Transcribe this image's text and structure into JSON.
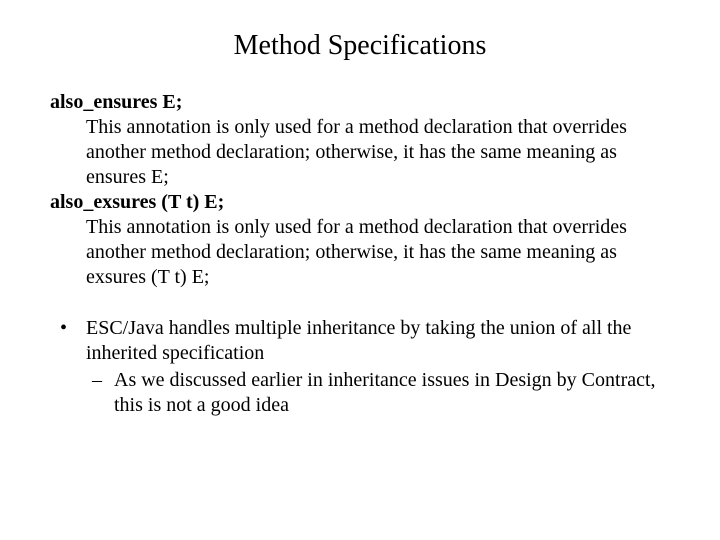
{
  "title": "Method Specifications",
  "specs": [
    {
      "term": "also_ensures E;",
      "desc": "This annotation is only used for a method declaration that overrides another method declaration; otherwise, it has the same meaning as ensures E;"
    },
    {
      "term": "also_exsures (T t) E;",
      "desc": "This annotation is only used for a method declaration that overrides another method declaration; otherwise, it has the same meaning as exsures (T t) E;"
    }
  ],
  "bullets": [
    {
      "text": "ESC/Java handles multiple inheritance by taking the union of all the inherited specification",
      "sub": [
        "As we discussed earlier in inheritance issues in Design by Contract, this is not a good idea"
      ]
    }
  ]
}
